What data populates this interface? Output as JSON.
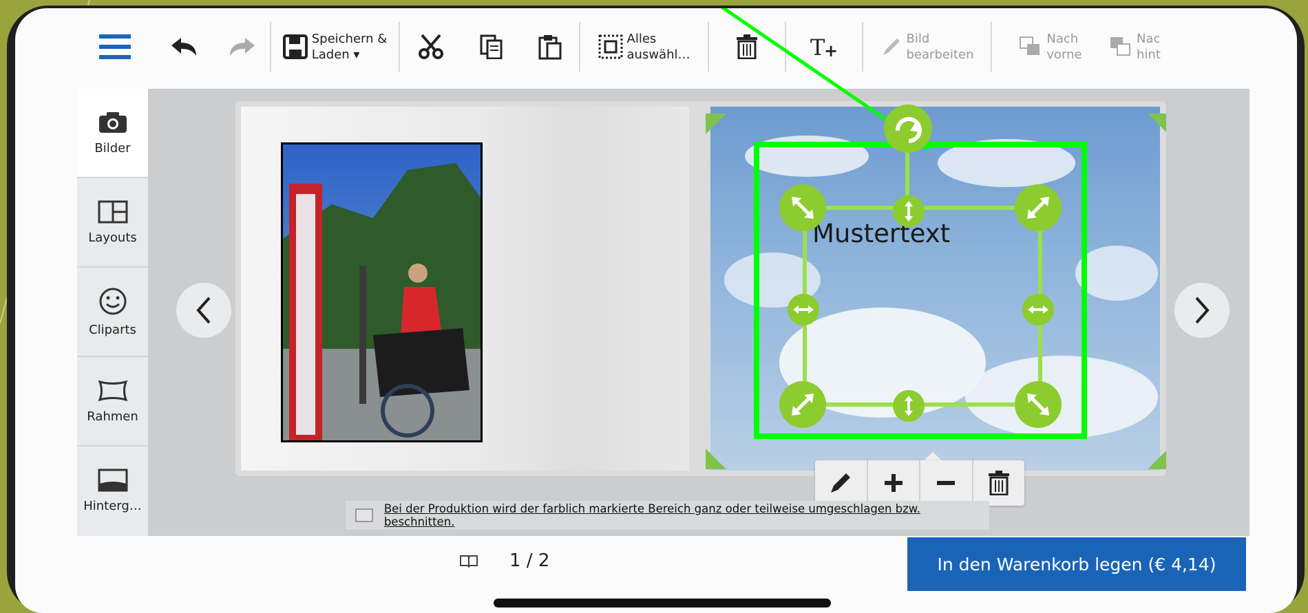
{
  "toolbar": {
    "save_label_1": "Speichern &",
    "save_label_2": "Laden ▾",
    "select_label_1": "Alles",
    "select_label_2": "auswähl…",
    "edit_image_1": "Bild",
    "edit_image_2": "bearbeiten",
    "front_1": "Nach",
    "front_2": "vorne",
    "back_1": "Nac",
    "back_2": "hint"
  },
  "sidebar": {
    "items": [
      {
        "label": "Bilder",
        "icon": "camera-icon"
      },
      {
        "label": "Layouts",
        "icon": "layout-icon"
      },
      {
        "label": "Cliparts",
        "icon": "smiley-icon"
      },
      {
        "label": "Rahmen",
        "icon": "frame-icon"
      },
      {
        "label": "Hinterg…",
        "icon": "background-icon"
      }
    ]
  },
  "canvas": {
    "text_box": "Mustertext"
  },
  "notice": {
    "text": "Bei der Produktion wird der farblich markierte Bereich ganz oder teilweise umgeschlagen bzw. beschnitten."
  },
  "footer": {
    "page_indicator": "1 / 2",
    "cart_button": "In den Warenkorb legen (€ 4,14)"
  },
  "colors": {
    "accent_blue": "#1a64b8",
    "highlight_green": "#00ff00",
    "handle_green": "#8ccc2e"
  }
}
